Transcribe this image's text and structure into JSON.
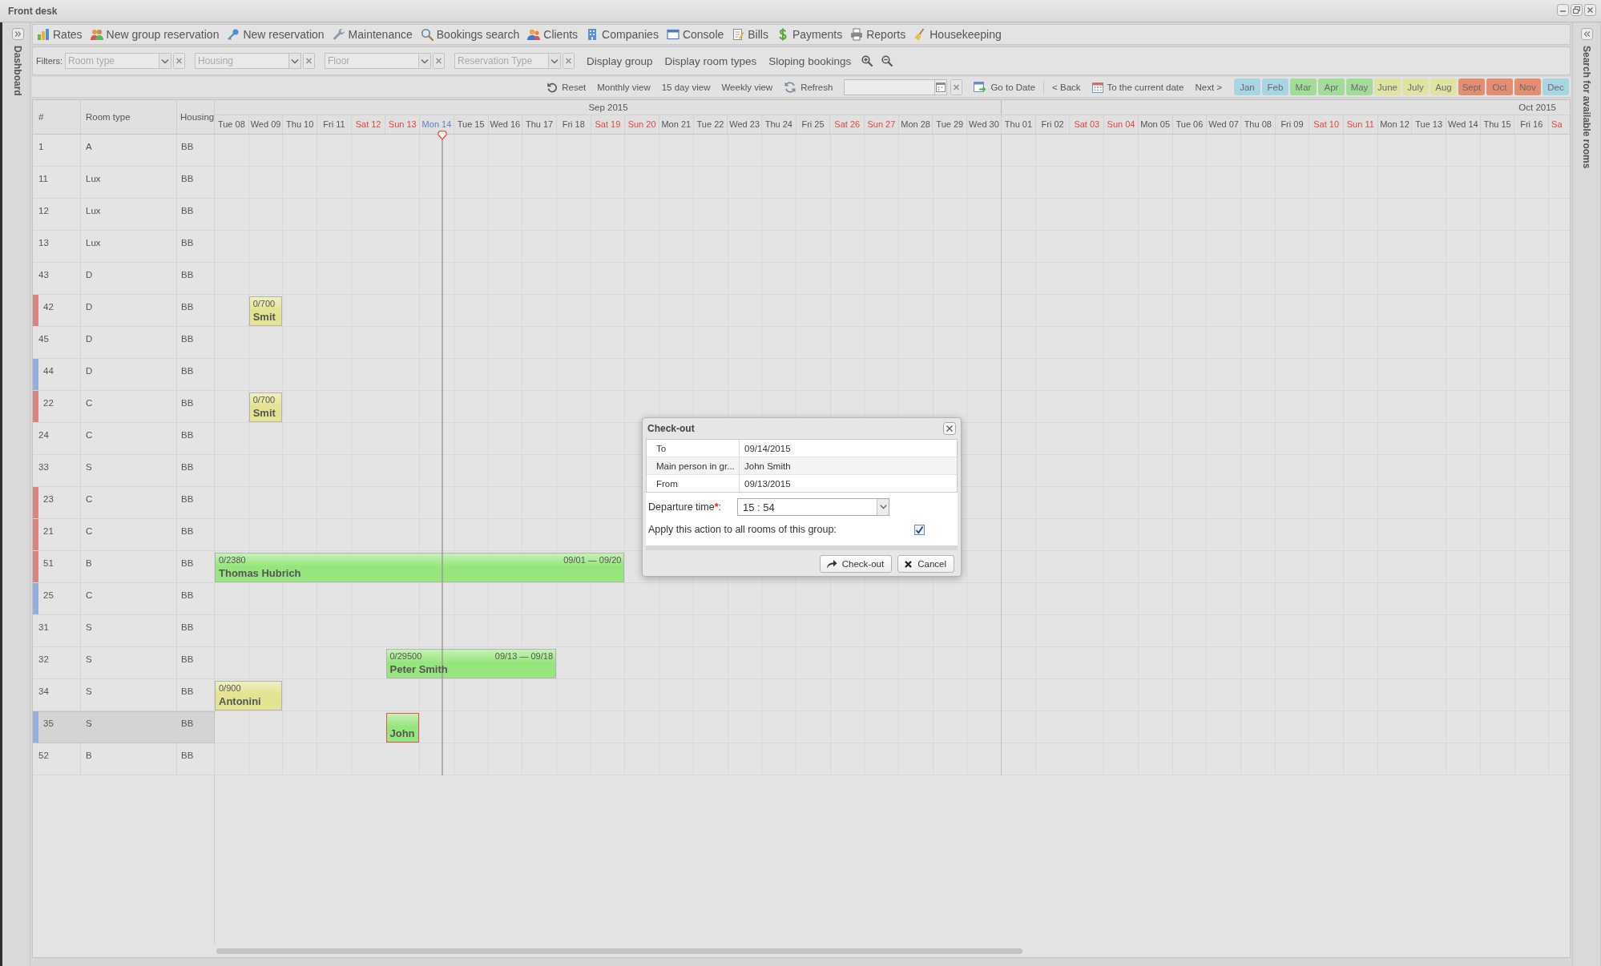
{
  "window": {
    "title": "Front desk"
  },
  "left_panel": {
    "title": "Dashboard"
  },
  "right_panel": {
    "title": "Search for available rooms"
  },
  "menu": [
    "Rates",
    "New group reservation",
    "New reservation",
    "Maintenance",
    "Bookings search",
    "Clients",
    "Companies",
    "Console",
    "Bills",
    "Payments",
    "Reports",
    "Housekeeping"
  ],
  "filters": {
    "label": "Filters:",
    "selects": [
      {
        "placeholder": "Room type"
      },
      {
        "placeholder": "Housing"
      },
      {
        "placeholder": "Floor"
      },
      {
        "placeholder": "Reservation Type"
      }
    ],
    "buttons": [
      "Display group",
      "Display room types",
      "Sloping bookings"
    ]
  },
  "toolbar": {
    "view_buttons": [
      "Reset",
      "Monthly view",
      "15 day view",
      "Weekly view",
      "Refresh"
    ],
    "nav_buttons": [
      "Go to Date",
      "< Back",
      "To the current date",
      "Next >"
    ],
    "months": [
      {
        "label": "Jan",
        "color": "#a9d4e2"
      },
      {
        "label": "Feb",
        "color": "#a9d4e2"
      },
      {
        "label": "Mar",
        "color": "#a3dc99"
      },
      {
        "label": "Apr",
        "color": "#a3dc99"
      },
      {
        "label": "May",
        "color": "#a3dc99"
      },
      {
        "label": "June",
        "color": "#e1e3a3"
      },
      {
        "label": "July",
        "color": "#e1e3a3"
      },
      {
        "label": "Aug",
        "color": "#e1e3a3"
      },
      {
        "label": "Sept",
        "color": "#e58d70"
      },
      {
        "label": "Oct",
        "color": "#e58d70"
      },
      {
        "label": "Nov",
        "color": "#e58d70"
      },
      {
        "label": "Dec",
        "color": "#a9d4e2"
      }
    ]
  },
  "scheduler": {
    "columns": [
      "#",
      "Room type",
      "Housing"
    ],
    "months": [
      {
        "label": "Sep 2015",
        "days": [
          {
            "label": "Tue 08",
            "kind": "weekday"
          },
          {
            "label": "Wed 09",
            "kind": "weekday"
          },
          {
            "label": "Thu 10",
            "kind": "weekday"
          },
          {
            "label": "Fri 11",
            "kind": "weekday"
          },
          {
            "label": "Sat 12",
            "kind": "weekend"
          },
          {
            "label": "Sun 13",
            "kind": "weekend"
          },
          {
            "label": "Mon 14",
            "kind": "today"
          },
          {
            "label": "Tue 15",
            "kind": "weekday"
          },
          {
            "label": "Wed 16",
            "kind": "weekday"
          },
          {
            "label": "Thu 17",
            "kind": "weekday"
          },
          {
            "label": "Fri 18",
            "kind": "weekday"
          },
          {
            "label": "Sat 19",
            "kind": "weekend"
          },
          {
            "label": "Sun 20",
            "kind": "weekend"
          },
          {
            "label": "Mon 21",
            "kind": "weekday"
          },
          {
            "label": "Tue 22",
            "kind": "weekday"
          },
          {
            "label": "Wed 23",
            "kind": "weekday"
          },
          {
            "label": "Thu 24",
            "kind": "weekday"
          },
          {
            "label": "Fri 25",
            "kind": "weekday"
          },
          {
            "label": "Sat 26",
            "kind": "weekend"
          },
          {
            "label": "Sun 27",
            "kind": "weekend"
          },
          {
            "label": "Mon 28",
            "kind": "weekday"
          },
          {
            "label": "Tue 29",
            "kind": "weekday"
          },
          {
            "label": "Wed 30",
            "kind": "weekday"
          }
        ]
      },
      {
        "label": "Oct 2015",
        "days": [
          {
            "label": "Thu 01",
            "kind": "weekday"
          },
          {
            "label": "Fri 02",
            "kind": "weekday"
          },
          {
            "label": "Sat 03",
            "kind": "weekend"
          },
          {
            "label": "Sun 04",
            "kind": "weekend"
          },
          {
            "label": "Mon 05",
            "kind": "weekday"
          },
          {
            "label": "Tue 06",
            "kind": "weekday"
          },
          {
            "label": "Wed 07",
            "kind": "weekday"
          },
          {
            "label": "Thu 08",
            "kind": "weekday"
          },
          {
            "label": "Fri 09",
            "kind": "weekday"
          },
          {
            "label": "Sat 10",
            "kind": "weekend"
          },
          {
            "label": "Sun 11",
            "kind": "weekend"
          },
          {
            "label": "Mon 12",
            "kind": "weekday"
          },
          {
            "label": "Tue 13",
            "kind": "weekday"
          },
          {
            "label": "Wed 14",
            "kind": "weekday"
          },
          {
            "label": "Thu 15",
            "kind": "weekday"
          },
          {
            "label": "Fri 16",
            "kind": "weekday"
          },
          {
            "label": "Sa",
            "kind": "weekend"
          }
        ]
      }
    ],
    "rows": [
      {
        "number": "1",
        "room_type": "A",
        "housing": "BB",
        "selected": false
      },
      {
        "number": "11",
        "room_type": "Lux",
        "housing": "BB",
        "selected": false
      },
      {
        "number": "12",
        "room_type": "Lux",
        "housing": "BB",
        "selected": false
      },
      {
        "number": "13",
        "room_type": "Lux",
        "housing": "BB",
        "selected": false
      },
      {
        "number": "43",
        "room_type": "D",
        "housing": "BB",
        "selected": false
      },
      {
        "number": "42",
        "room_type": "D",
        "housing": "BB",
        "selected": false,
        "color": "#d98383",
        "bookings": [
          {
            "amount": "0/700",
            "guest": "Smit",
            "color": "#e4e391",
            "selected": false
          }
        ]
      },
      {
        "number": "45",
        "room_type": "D",
        "housing": "BB",
        "selected": false
      },
      {
        "number": "44",
        "room_type": "D",
        "housing": "BB",
        "selected": false,
        "color": "#95aee0"
      },
      {
        "number": "22",
        "room_type": "C",
        "housing": "BB",
        "selected": false,
        "color": "#d98383",
        "bookings": [
          {
            "amount": "0/700",
            "guest": "Smit",
            "color": "#e4e391",
            "selected": false
          }
        ]
      },
      {
        "number": "24",
        "room_type": "C",
        "housing": "BB",
        "selected": false
      },
      {
        "number": "33",
        "room_type": "S",
        "housing": "BB",
        "selected": false
      },
      {
        "number": "23",
        "room_type": "C",
        "housing": "BB",
        "selected": false,
        "color": "#d98383"
      },
      {
        "number": "21",
        "room_type": "C",
        "housing": "BB",
        "selected": false,
        "color": "#d98383"
      },
      {
        "number": "51",
        "room_type": "B",
        "housing": "BB",
        "selected": false,
        "color": "#d98383",
        "bookings": [
          {
            "amount": "0/2380",
            "guest": "Thomas Hubrich",
            "dates": "09/01 — 09/20",
            "color": "#97e67d",
            "selected": false
          }
        ]
      },
      {
        "number": "25",
        "room_type": "C",
        "housing": "BB",
        "selected": false,
        "color": "#95aee0"
      },
      {
        "number": "31",
        "room_type": "S",
        "housing": "BB",
        "selected": false
      },
      {
        "number": "32",
        "room_type": "S",
        "housing": "BB",
        "selected": false,
        "bookings": [
          {
            "amount": "0/29500",
            "guest": "Peter Smith",
            "dates": "09/13 — 09/18",
            "color": "#97e67d",
            "selected": false
          }
        ]
      },
      {
        "number": "34",
        "room_type": "S",
        "housing": "BB",
        "selected": false,
        "bookings": [
          {
            "amount": "0/900",
            "guest": "Antonini",
            "color": "#e4e391",
            "selected": false
          }
        ]
      },
      {
        "number": "35",
        "room_type": "S",
        "housing": "BB",
        "selected": true,
        "color": "#95aee0",
        "bookings": [
          {
            "guest": "John",
            "color": "#97e67d",
            "selected": true
          }
        ]
      },
      {
        "number": "52",
        "room_type": "B",
        "housing": "BB",
        "selected": false
      }
    ]
  },
  "dialog": {
    "title": "Check-out",
    "details": [
      {
        "label": "To",
        "value": "09/14/2015"
      },
      {
        "label": "Main person in gr...",
        "value": "John Smith"
      },
      {
        "label": "From",
        "value": "09/13/2015"
      }
    ],
    "departure": {
      "label": "Departure time",
      "required_mark": "*",
      "suffix": ":",
      "value": "15 : 54"
    },
    "apply_all": {
      "label": "Apply this action to all rooms of this group:",
      "checked": true
    },
    "buttons": [
      "Check-out",
      "Cancel"
    ]
  }
}
